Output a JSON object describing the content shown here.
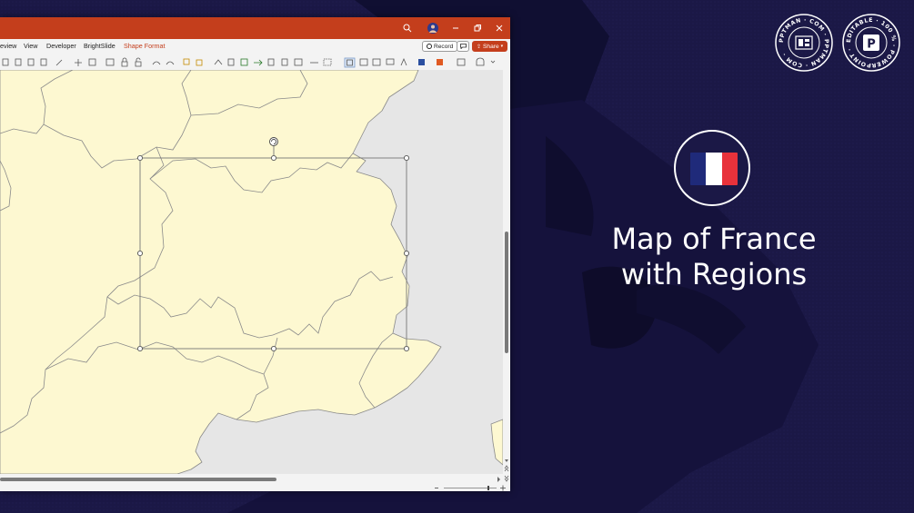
{
  "colors": {
    "background": "#1b1846",
    "titlebar": "#c43e1c",
    "map_fill": "#fdf8d1",
    "map_stroke": "#8a8a8a",
    "canvas_bg": "#e6e6e6",
    "flag_blue": "#1f2a7a",
    "flag_white": "#ffffff",
    "flag_red": "#e8323b"
  },
  "window": {
    "titlebar_icons": [
      "search-icon",
      "profile-avatar",
      "minimize-icon",
      "restore-icon",
      "close-icon"
    ],
    "tabs": [
      {
        "label": "eview",
        "active": false
      },
      {
        "label": "View",
        "active": false
      },
      {
        "label": "Developer",
        "active": false
      },
      {
        "label": "BrightSlide",
        "active": false
      },
      {
        "label": "Shape Format",
        "active": true
      }
    ],
    "record_label": "Record",
    "share_label": "Share",
    "comments_icon": "comment-icon"
  },
  "hero": {
    "title_line1": "Map of France",
    "title_line2": "with Regions"
  },
  "badges": [
    {
      "ring_text": "PPTMAN · COM · PPTMAN · COM ·",
      "icon": "pptman-logo-icon"
    },
    {
      "ring_text": "EDITABLE · 100 % · POWERPOINT ·",
      "icon": "powerpoint-p-icon"
    }
  ]
}
